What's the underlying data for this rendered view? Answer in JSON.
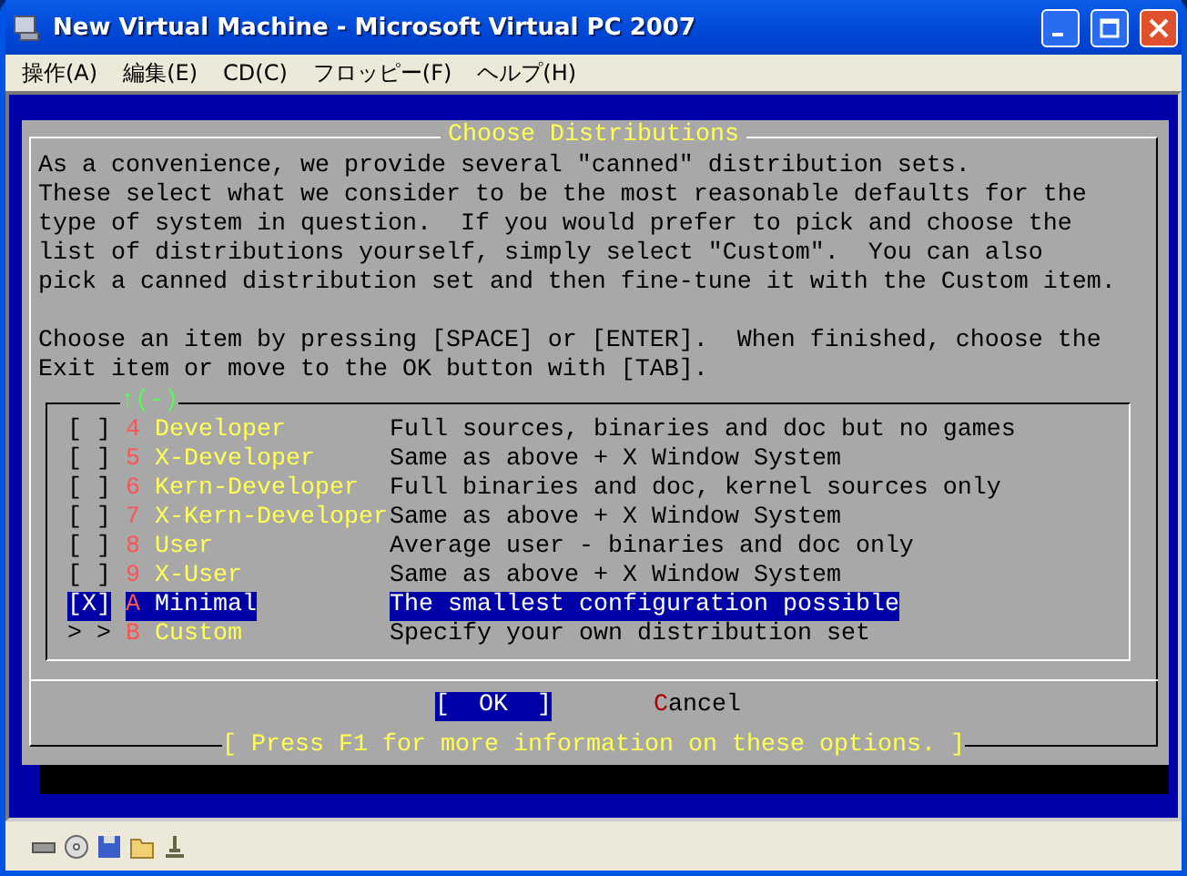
{
  "window": {
    "title": "New Virtual Machine - Microsoft Virtual PC 2007"
  },
  "menu": [
    "操作(A)",
    "編集(E)",
    "CD(C)",
    "フロッピー(F)",
    "ヘルプ(H)"
  ],
  "dialog": {
    "title": "Choose Distributions",
    "intro": [
      "As a convenience, we provide several \"canned\" distribution sets.",
      "These select what we consider to be the most reasonable defaults for the",
      "type of system in question.  If you would prefer to pick and choose the",
      "list of distributions yourself, simply select \"Custom\".  You can also",
      "pick a canned distribution set and then fine-tune it with the Custom item."
    ],
    "instructions": [
      "Choose an item by pressing [SPACE] or [ENTER].  When finished, choose the",
      "Exit item or move to the OK button with [TAB]."
    ],
    "scroll_indicator": "↑(-)",
    "items": [
      {
        "marker": "[ ]",
        "key": "4",
        "name": "Developer",
        "description": "Full sources, binaries and doc but no games",
        "selected": false
      },
      {
        "marker": "[ ]",
        "key": "5",
        "name": "X-Developer",
        "description": "Same as above + X Window System",
        "selected": false
      },
      {
        "marker": "[ ]",
        "key": "6",
        "name": "Kern-Developer",
        "description": "Full binaries and doc, kernel sources only",
        "selected": false
      },
      {
        "marker": "[ ]",
        "key": "7",
        "name": "X-Kern-Developer",
        "description": "Same as above + X Window System",
        "selected": false
      },
      {
        "marker": "[ ]",
        "key": "8",
        "name": "User",
        "description": "Average user - binaries and doc only",
        "selected": false
      },
      {
        "marker": "[ ]",
        "key": "9",
        "name": "X-User",
        "description": "Same as above + X Window System",
        "selected": false
      },
      {
        "marker": "[X]",
        "key": "A",
        "name": "Minimal",
        "description": "The smallest configuration possible",
        "selected": true
      },
      {
        "marker": "> >",
        "key": "B",
        "name": "Custom",
        "description": "Specify your own distribution set",
        "selected": false
      }
    ],
    "buttons": [
      {
        "label": "[  OK  ]",
        "selected": true
      },
      {
        "label": "Cancel",
        "selected": false
      }
    ],
    "help": "[ Press F1 for more information on these options. ]"
  }
}
